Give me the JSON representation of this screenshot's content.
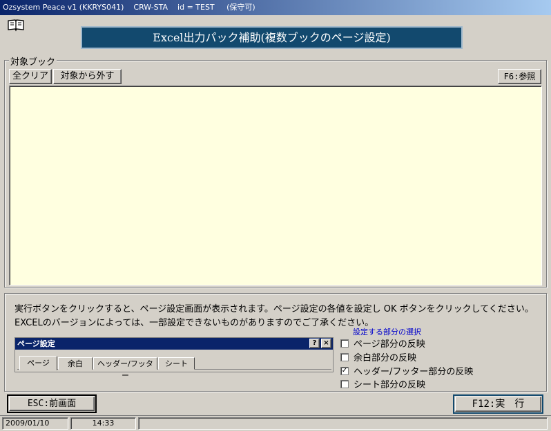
{
  "window": {
    "title": "Ozsystem Peace v1 (KKRYS041)    CRW-STA    id = TEST     (保守可)"
  },
  "header": {
    "icon": "book-icon",
    "banner": "Excel出力パック補助(複数ブックのページ設定)"
  },
  "target_books": {
    "group_label": "対象ブック",
    "clear_all": "全クリア",
    "remove": "対象から外す",
    "browse": "F6:参照"
  },
  "info": {
    "line1": "実行ボタンをクリックすると、ページ設定画面が表示されます。ページ設定の各値を設定し OK ボタンをクリックしてください。",
    "line2": "EXCELのバージョンによっては、一部設定できないものがありますのでご了承ください。"
  },
  "page_setup_preview": {
    "title": "ページ設定",
    "help": "?",
    "close": "×",
    "tabs": [
      "ページ",
      "余白",
      "ヘッダー/フッター",
      "シート"
    ]
  },
  "options": {
    "label": "設定する部分の選択",
    "items": [
      {
        "label": "ページ部分の反映",
        "checked": false
      },
      {
        "label": "余白部分の反映",
        "checked": false
      },
      {
        "label": "ヘッダー/フッター部分の反映",
        "checked": true
      },
      {
        "label": "シート部分の反映",
        "checked": false
      }
    ]
  },
  "footer": {
    "esc": "ESC:前画面",
    "execute": "F12:実　行"
  },
  "statusbar": {
    "date": "2009/01/10",
    "time": "14:33"
  },
  "colors": {
    "banner": "#12496e",
    "list_bg": "#ffffe0",
    "title_start": "#0a246a",
    "options_label": "#0000cc"
  }
}
